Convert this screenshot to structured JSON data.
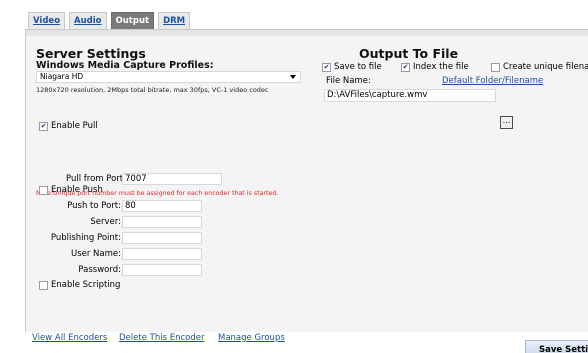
{
  "tabs": [
    {
      "label": "Video",
      "active": false
    },
    {
      "label": "Audio",
      "active": false
    },
    {
      "label": "Output",
      "active": true
    },
    {
      "label": "DRM",
      "active": false
    }
  ],
  "server_settings": {
    "title": "Server Settings",
    "profiles_label": "Windows Media Capture Profiles:",
    "profile_selected": "Niagara HD",
    "profile_description": "1280x720 resolution, 2Mbps total bitrate, max 30fps, VC-1 video codec"
  },
  "pull": {
    "enable_label": "Enable Pull",
    "enabled": true,
    "port_label": "Pull from Port:",
    "port_value": "7007",
    "note": "Note:Unique port number must be assigned for each encoder that is started."
  },
  "push": {
    "enable_label": "Enable Push",
    "enabled": false,
    "port_label": "Push to Port:",
    "port_value": "80",
    "server_label": "Server:",
    "server_value": "",
    "publishing_point_label": "Publishing Point:",
    "publishing_point_value": "",
    "username_label": "User Name:",
    "username_value": "",
    "password_label": "Password:",
    "password_value": ""
  },
  "scripting": {
    "enable_label": "Enable Scripting",
    "enabled": false
  },
  "output_file": {
    "title": "Output To File",
    "save_label": "Save to file",
    "save_checked": true,
    "index_label": "Index the file",
    "index_checked": true,
    "unique_label": "Create unique filena",
    "unique_checked": false,
    "file_name_label": "File Name:",
    "default_link": "Default Folder/Filename",
    "file_path": "D:\\AVFiles\\capture.wmv",
    "browse_label": "..."
  },
  "footer": {
    "view_all": "View All Encoders",
    "delete": "Delete This Encoder",
    "manage": "Manage Groups",
    "save": "Save Settings"
  },
  "colors": {
    "link": "#1f4fa0",
    "note": "#e8242a",
    "active_tab": "#7a7a7a",
    "panel": "#f4f4f4"
  }
}
